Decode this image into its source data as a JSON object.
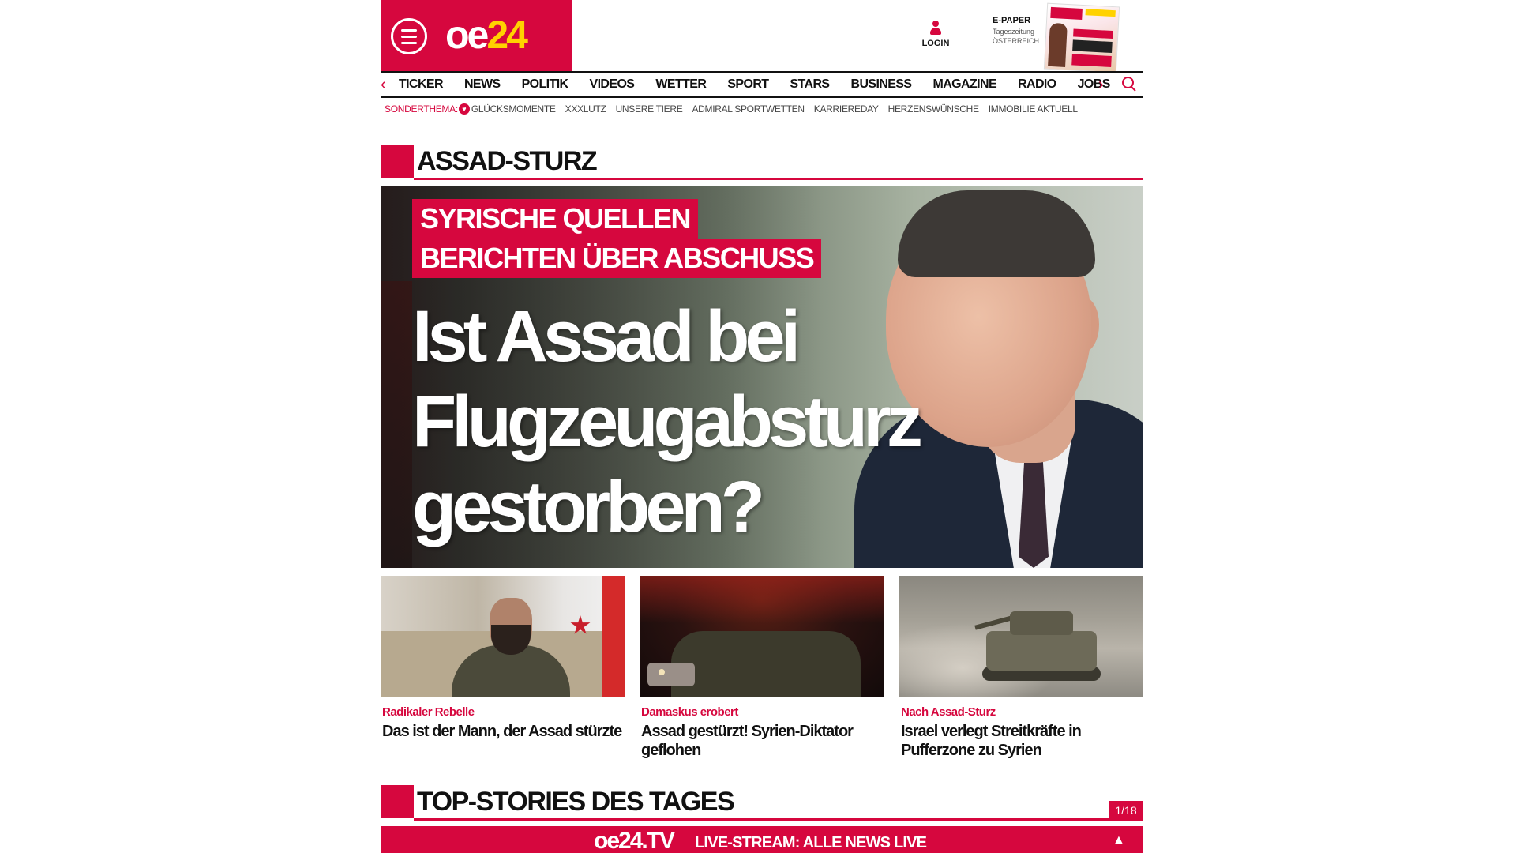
{
  "brand": {
    "logo_oe": "oe",
    "logo_24": "24"
  },
  "header": {
    "login_label": "LOGIN",
    "epaper_title": "E-PAPER",
    "epaper_sub1": "Tageszeitung",
    "epaper_sub2": "ÖSTERREICH"
  },
  "nav": {
    "prev": "‹",
    "next": "›",
    "items": [
      "TICKER",
      "NEWS",
      "POLITIK",
      "VIDEOS",
      "WETTER",
      "SPORT",
      "STARS",
      "BUSINESS",
      "MAGAZINE",
      "RADIO",
      "JOBS"
    ]
  },
  "subnav": {
    "label": "SONDERTHEMA:",
    "items": [
      "GLÜCKSMOMENTE",
      "XXXLUTZ",
      "UNSERE TIERE",
      "ADMIRAL SPORTWETTEN",
      "KARRIEREDAY",
      "HERZENSWÜNSCHE",
      "IMMOBILIE AKTUELL"
    ]
  },
  "section_assad": {
    "title": "ASSAD-STURZ"
  },
  "hero": {
    "kicker_line1": "SYRISCHE QUELLEN",
    "kicker_line2": "BERICHTEN ÜBER ABSCHUSS",
    "headline_line1": "Ist Assad bei",
    "headline_line2": "Flugzeugabsturz",
    "headline_line3": "gestorben?"
  },
  "cards": [
    {
      "kicker": "Radikaler Rebelle",
      "title": "Das ist der Mann, der Assad stürzte"
    },
    {
      "kicker": "Damaskus erobert",
      "title": "Assad gestürzt! Syrien-Diktator geflohen"
    },
    {
      "kicker": "Nach Assad-Sturz",
      "title": "Israel verlegt Streitkräfte in Pufferzone zu Syrien"
    }
  ],
  "section_top": {
    "title": "TOP-STORIES DES TAGES",
    "pager": "1/18"
  },
  "livebar": {
    "brand": "oe24.TV",
    "text": "LIVE-STREAM: ALLE NEWS LIVE",
    "up": "▲"
  },
  "colors": {
    "brand_red": "#d6073e",
    "logo_yellow": "#ffd200"
  }
}
